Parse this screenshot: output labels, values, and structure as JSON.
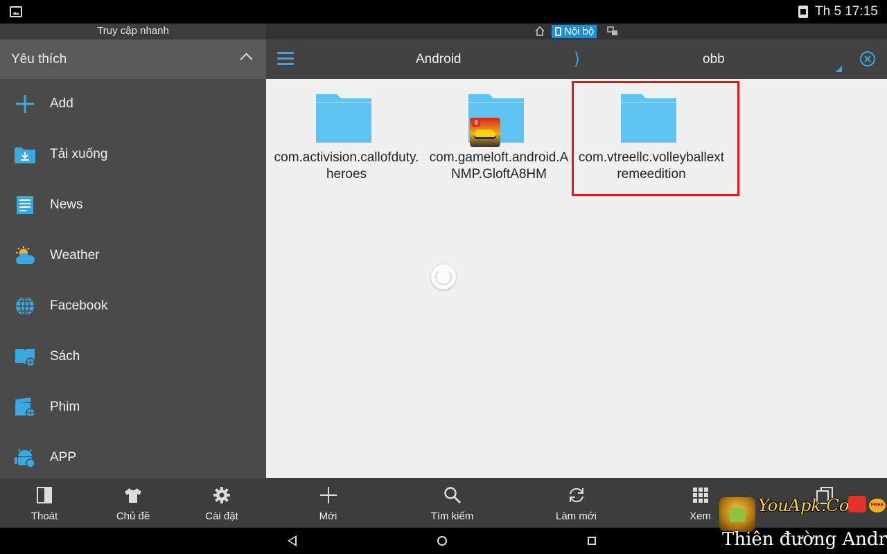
{
  "status_bar": {
    "time": "Th 5 17:15",
    "left_icon": "gallery-icon",
    "right_icon": "sim-card-icon"
  },
  "left_panel": {
    "quick_access_title": "Truy cập nhanh",
    "favorites_title": "Yêu thích",
    "items": [
      {
        "label": "Add",
        "icon": "plus-icon"
      },
      {
        "label": "Tải xuống",
        "icon": "download-folder-icon"
      },
      {
        "label": "News",
        "icon": "news-icon"
      },
      {
        "label": "Weather",
        "icon": "weather-icon"
      },
      {
        "label": "Facebook",
        "icon": "globe-icon"
      },
      {
        "label": "Sách",
        "icon": "book-icon"
      },
      {
        "label": "Phim",
        "icon": "film-icon"
      },
      {
        "label": "APP",
        "icon": "android-icon"
      }
    ],
    "toolbar": [
      {
        "label": "Thoát",
        "icon": "exit-icon"
      },
      {
        "label": "Chủ đề",
        "icon": "theme-shirt-icon"
      },
      {
        "label": "Cài đặt",
        "icon": "gear-icon"
      }
    ]
  },
  "right_panel": {
    "location_label": "Nội bộ",
    "path": [
      "Android",
      "obb"
    ],
    "folders": [
      {
        "name": "com.activision.callofduty.heroes"
      },
      {
        "name": "com.gameloft.android.ANMP.GloftA8HM"
      },
      {
        "name": "com.vtreellc.volleyballextremeedition",
        "highlighted": true
      }
    ],
    "toolbar": [
      {
        "label": "Mới",
        "icon": "plus-icon"
      },
      {
        "label": "Tìm kiếm",
        "icon": "search-icon"
      },
      {
        "label": "Làm mới",
        "icon": "refresh-icon"
      },
      {
        "label": "Xem",
        "icon": "grid-view-icon"
      },
      {
        "label": "",
        "icon": "copy-icon"
      }
    ]
  },
  "watermark": {
    "site": "YouApk.Com",
    "tagline": "Thiên đường Android",
    "free_badge": "FREE"
  },
  "colors": {
    "accent": "#39a9e0",
    "panel_dark": "#4a4a4a",
    "toolbar": "#3d3d3d",
    "content_bg": "#f0f0f0",
    "highlight": "#e01818",
    "folder": "#5ec3f2"
  }
}
